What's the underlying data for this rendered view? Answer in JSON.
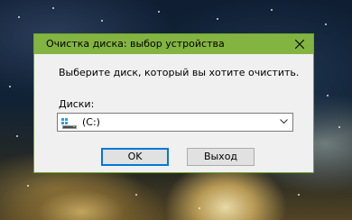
{
  "window": {
    "title": "Очистка диска: выбор устройства",
    "accent_color": "#83b441"
  },
  "dialog": {
    "prompt": "Выберите диск, который вы хотите очистить.",
    "drives_label": "Диски:",
    "drive_select": {
      "selected_value": "(C:)",
      "icon": "drive-icon"
    }
  },
  "buttons": {
    "ok_label": "OK",
    "exit_label": "Выход"
  },
  "icons": {
    "close": "close-icon",
    "dropdown": "chevron-down-icon"
  }
}
